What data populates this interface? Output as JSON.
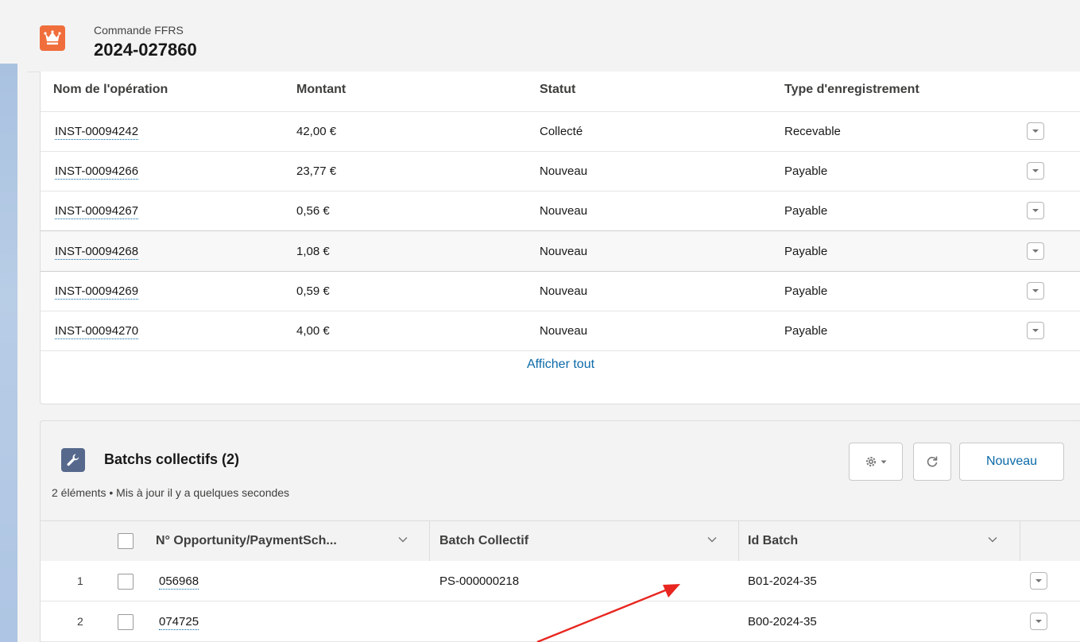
{
  "header": {
    "subtitle": "Commande FFRS",
    "title": "2024-027860",
    "icon": "crown-icon"
  },
  "operations": {
    "columns": [
      "Nom de l'opération",
      "Montant",
      "Statut",
      "Type d'enregistrement"
    ],
    "rows": [
      {
        "name": "INST-00094242",
        "amount": "42,00 €",
        "status": "Collecté",
        "type": "Recevable"
      },
      {
        "name": "INST-00094266",
        "amount": "23,77 €",
        "status": "Nouveau",
        "type": "Payable"
      },
      {
        "name": "INST-00094267",
        "amount": "0,56 €",
        "status": "Nouveau",
        "type": "Payable"
      },
      {
        "name": "INST-00094268",
        "amount": "1,08 €",
        "status": "Nouveau",
        "type": "Payable"
      },
      {
        "name": "INST-00094269",
        "amount": "0,59 €",
        "status": "Nouveau",
        "type": "Payable"
      },
      {
        "name": "INST-00094270",
        "amount": "4,00 €",
        "status": "Nouveau",
        "type": "Payable"
      }
    ],
    "show_all": "Afficher tout"
  },
  "batches": {
    "title": "Batchs collectifs (2)",
    "subtitle": "2 éléments • Mis à jour il y a quelques secondes",
    "icon": "wrench-icon",
    "new_button": "Nouveau",
    "columns": [
      "N° Opportunity/PaymentSch...",
      "Batch Collectif",
      "Id Batch"
    ],
    "rows": [
      {
        "num": "1",
        "opportunity": "056968",
        "batch": "PS-000000218",
        "id": "B01-2024-35"
      },
      {
        "num": "2",
        "opportunity": "074725",
        "batch": "",
        "id": "B00-2024-35"
      }
    ]
  },
  "colors": {
    "link": "#0b6aa8",
    "header_icon_bg": "#f06e3b",
    "batch_icon_bg": "#56688c",
    "annotation_arrow": "#e8261f"
  }
}
